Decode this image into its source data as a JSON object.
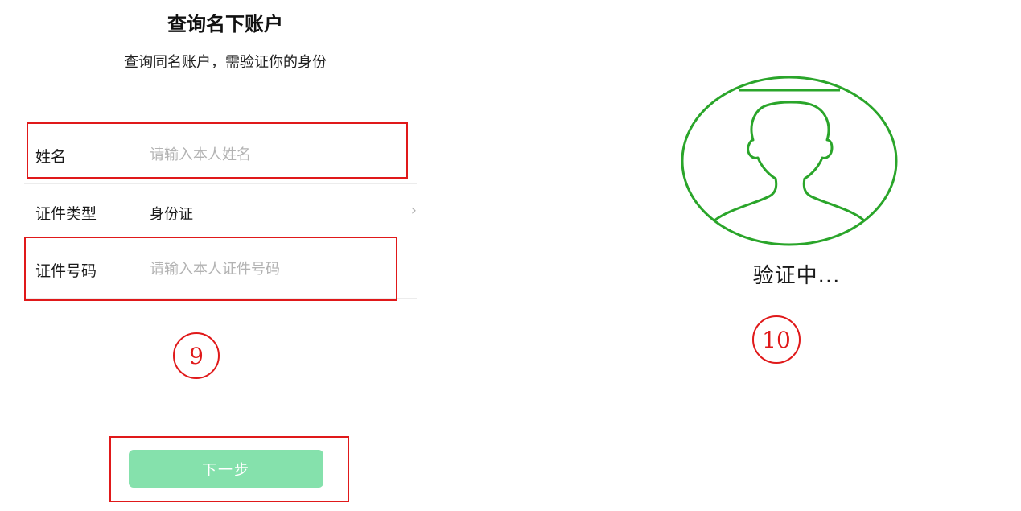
{
  "page": {
    "title": "查询名下账户",
    "subtitle": "查询同名账户，需验证你的身份"
  },
  "form": {
    "name": {
      "label": "姓名",
      "placeholder": "请输入本人姓名",
      "value": ""
    },
    "id_type": {
      "label": "证件类型",
      "value": "身份证"
    },
    "id_number": {
      "label": "证件号码",
      "placeholder": "请输入本人证件号码",
      "value": ""
    }
  },
  "next_button": {
    "label": "下一步"
  },
  "annotations": {
    "step_left": "9",
    "step_right": "10",
    "highlight_color": "#e0191a"
  },
  "verification": {
    "status": "验证中..."
  },
  "colors": {
    "button_bg": "#85e1ac",
    "face_outline": "#2aa52a",
    "placeholder": "#b3b3b3"
  },
  "icons": {
    "chevron": "chevron-right-icon",
    "face": "face-silhouette-icon"
  }
}
